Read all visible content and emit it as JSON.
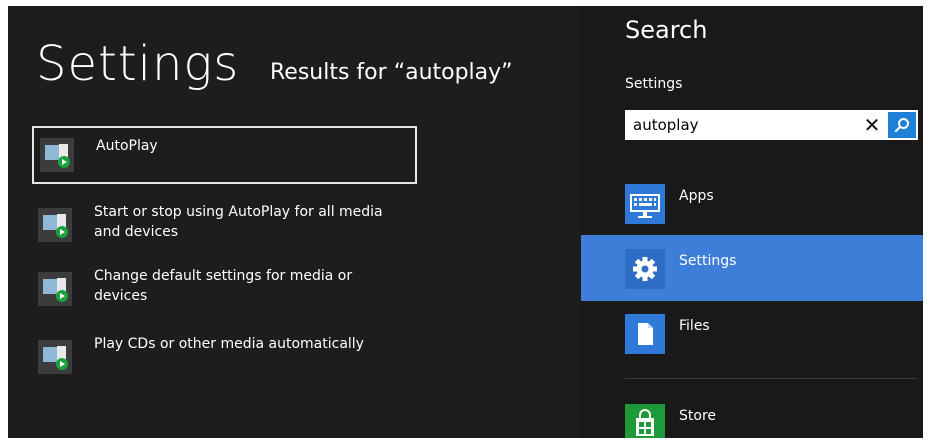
{
  "left": {
    "title": "Settings",
    "results_prefix": "Results for ",
    "query_display": "“autoplay”",
    "items": [
      {
        "label": "AutoPlay"
      },
      {
        "label": "Start or stop using AutoPlay for all media and devices"
      },
      {
        "label": "Change default settings for media or devices"
      },
      {
        "label": "Play CDs or other media automatically"
      }
    ]
  },
  "search": {
    "title": "Search",
    "scope": "Settings",
    "value": "autoplay",
    "clear_glyph": "✕"
  },
  "apps": [
    {
      "label": "Apps",
      "icon": "apps-keyboard-icon"
    },
    {
      "label": "Settings",
      "icon": "gear-icon"
    },
    {
      "label": "Files",
      "icon": "file-icon"
    },
    {
      "label": "Store",
      "icon": "store-icon"
    }
  ],
  "colors": {
    "accent": "#3d7ed8",
    "search_button": "#1e80d6",
    "background": "#1d1d1d"
  }
}
